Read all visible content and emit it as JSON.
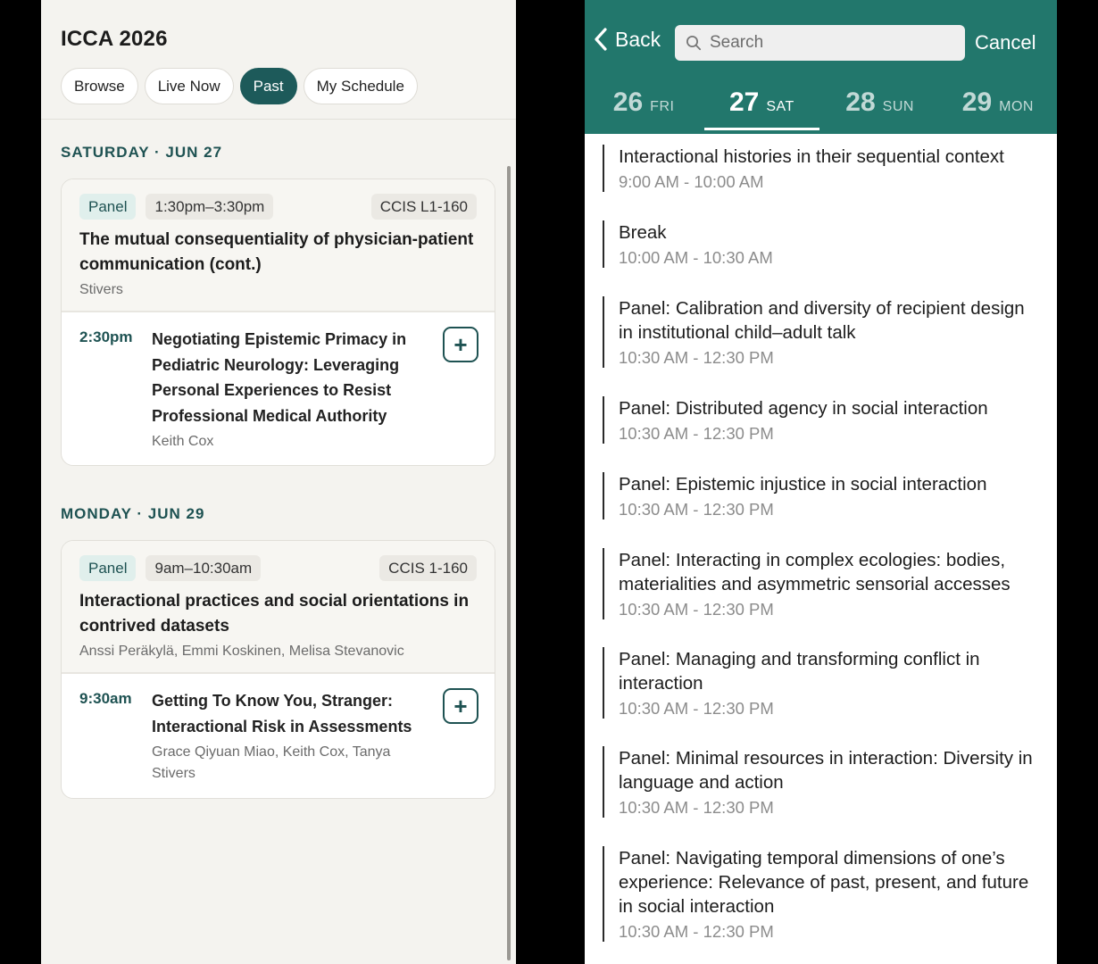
{
  "left": {
    "app_title": "ICCA 2026",
    "tabs": [
      {
        "label": "Browse",
        "active": false
      },
      {
        "label": "Live Now",
        "active": false
      },
      {
        "label": "Past",
        "active": true
      },
      {
        "label": "My Schedule",
        "active": false
      }
    ],
    "groups": [
      {
        "heading": "SATURDAY · JUN 27",
        "card": {
          "type": "Panel",
          "time": "1:30pm–3:30pm",
          "room": "CCIS L1-160",
          "title": "The mutual consequentiality of physician-patient communication (cont.)",
          "people": "Stivers",
          "talk": {
            "time": "2:30pm",
            "title": "Negotiating Epistemic Primacy in Pediatric Neurology: Leveraging Personal Experiences to Resist Professional Medical Authority",
            "people": "Keith Cox",
            "add": "+"
          }
        }
      },
      {
        "heading": "MONDAY · JUN 29",
        "card": {
          "type": "Panel",
          "time": "9am–10:30am",
          "room": "CCIS 1-160",
          "title": "Interactional practices and social orientations in contrived datasets",
          "people": "Anssi Peräkylä, Emmi Koskinen, Melisa Stevanovic",
          "talk": {
            "time": "9:30am",
            "title": "Getting To Know You, Stranger: Interactional Risk in Assessments",
            "people": "Grace Qiyuan Miao, Keith Cox, Tanya Stivers",
            "add": "+"
          }
        }
      }
    ]
  },
  "right": {
    "back_label": "Back",
    "search_placeholder": "Search",
    "cancel_label": "Cancel",
    "accent_color": "#22776c",
    "days": [
      {
        "num": "26",
        "dow": "FRI",
        "active": false
      },
      {
        "num": "27",
        "dow": "SAT",
        "active": true
      },
      {
        "num": "28",
        "dow": "SUN",
        "active": false
      },
      {
        "num": "29",
        "dow": "MON",
        "active": false
      }
    ],
    "sessions": [
      {
        "title": "Interactional histories in their sequential context",
        "time": "9:00 AM - 10:00 AM"
      },
      {
        "title": "Break",
        "time": "10:00 AM - 10:30 AM"
      },
      {
        "title": "Panel: Calibration and diversity of recipient design in institutional child–adult talk",
        "time": "10:30 AM - 12:30 PM"
      },
      {
        "title": "Panel: Distributed agency in social interaction",
        "time": "10:30 AM - 12:30 PM"
      },
      {
        "title": "Panel: Epistemic injustice in social interaction",
        "time": "10:30 AM - 12:30 PM"
      },
      {
        "title": "Panel: Interacting in complex ecologies: bodies, materialities and asymmetric sensorial accesses",
        "time": "10:30 AM - 12:30 PM"
      },
      {
        "title": "Panel: Managing and transforming conflict in interaction",
        "time": "10:30 AM - 12:30 PM"
      },
      {
        "title": "Panel: Minimal resources in interaction: Diversity in language and action",
        "time": "10:30 AM - 12:30 PM"
      },
      {
        "title": "Panel: Navigating temporal dimensions of one’s experience: Relevance of past, present, and future in social interaction",
        "time": "10:30 AM - 12:30 PM"
      }
    ]
  }
}
